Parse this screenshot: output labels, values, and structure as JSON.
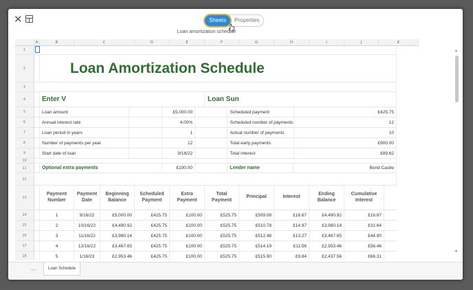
{
  "toolbar": {
    "tabs": [
      {
        "label": "Sheets",
        "active": true
      },
      {
        "label": "Properties",
        "active": false
      }
    ],
    "doc_title": "Loan amortization schedule"
  },
  "columns": [
    "A",
    "B",
    "C",
    "D",
    "E",
    "F",
    "G",
    "H",
    "I",
    "J",
    "K"
  ],
  "sheet": {
    "title": "Loan Amortization Schedule",
    "enter_heading": "Enter V",
    "summary_heading": "Loan Sun",
    "inputs": [
      {
        "row": "5",
        "label": "Loan amount",
        "value": "£5,000.00",
        "s_label": "Scheduled payment",
        "s_value": "£425.75"
      },
      {
        "row": "6",
        "label": "Annual interest rate",
        "value": "4.00%",
        "s_label": "Scheduled number of payments",
        "s_value": "12"
      },
      {
        "row": "7",
        "label": "Loan period in years",
        "value": "1",
        "s_label": "Actual number of payments",
        "s_value": "10"
      },
      {
        "row": "8",
        "label": "Number of payments per year",
        "value": "12",
        "s_label": "Total early payments",
        "s_value": "£900.00"
      },
      {
        "row": "9",
        "label": "Start date of loan",
        "value": "9/16/22",
        "s_label": "Total interest",
        "s_value": "£89.62"
      }
    ],
    "extra_label": "Optional extra payments",
    "extra_value": "£100.00",
    "lender_label": "Lender name",
    "lender_value": "Bond Castle",
    "table_headers": [
      "Payment Number",
      "Payment Date",
      "Beginning Balance",
      "Scheduled Payment",
      "Extra Payment",
      "Total Payment",
      "Principal",
      "Interest",
      "Ending Balance",
      "Cumulative Interest"
    ],
    "table_rows": [
      {
        "rn": "14",
        "cells": [
          "1",
          "9/16/22",
          "£5,000.00",
          "£425.75",
          "£100.00",
          "£525.75",
          "£509.08",
          "£16.67",
          "£4,490.92",
          "£16.67"
        ]
      },
      {
        "rn": "15",
        "cells": [
          "2",
          "10/16/22",
          "£4,490.92",
          "£425.75",
          "£100.00",
          "£525.75",
          "£510.78",
          "£14.97",
          "£3,980.14",
          "£31.64"
        ]
      },
      {
        "rn": "16",
        "cells": [
          "3",
          "11/16/22",
          "£3,980.14",
          "£425.75",
          "£100.00",
          "£525.75",
          "£512.48",
          "£13.27",
          "£3,467.65",
          "£44.90"
        ]
      },
      {
        "rn": "17",
        "cells": [
          "4",
          "12/16/22",
          "£3,467.65",
          "£425.75",
          "£100.00",
          "£525.75",
          "£514.19",
          "£11.56",
          "£2,953.46",
          "£56.46"
        ]
      },
      {
        "rn": "18",
        "cells": [
          "5",
          "1/16/23",
          "£2,953.46",
          "£425.75",
          "£100.00",
          "£525.75",
          "£515.90",
          "£9.84",
          "£2,437.56",
          "£66.31"
        ]
      }
    ]
  },
  "rownums": {
    "r1": "1",
    "r2": "2",
    "r3": "3",
    "r4": "4",
    "r10": "10",
    "r11": "11",
    "r12": "12",
    "r13": "13"
  },
  "bottom": {
    "more": "···",
    "sheet_tab": "Loan Schedule"
  },
  "scroll": {
    "up": "▲",
    "down": "▼"
  },
  "colors": {
    "accent": "#2b8ad8",
    "title_green": "#2f6e2f",
    "focus_ring": "#e4b43a"
  }
}
